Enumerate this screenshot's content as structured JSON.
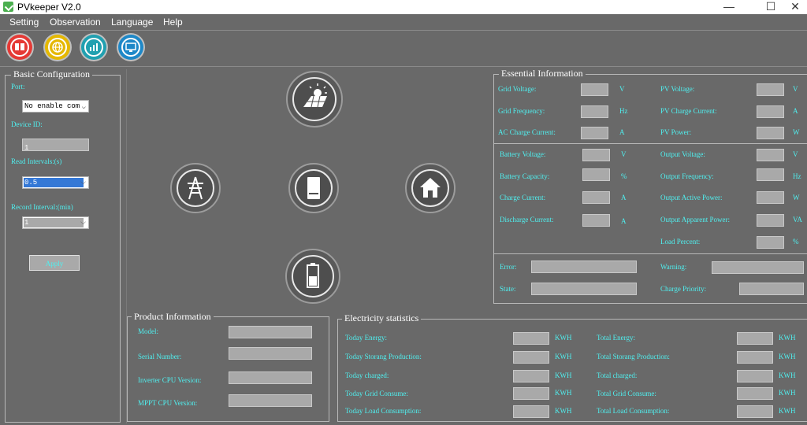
{
  "window": {
    "title": "PVkeeper V2.0",
    "minimize": "—",
    "maximize": "☐",
    "close": "✕"
  },
  "menu": [
    "Setting",
    "Observation",
    "Language",
    "Help"
  ],
  "toolbar": {
    "icons": [
      "book-icon",
      "globe-icon",
      "chart-icon",
      "monitor-icon"
    ]
  },
  "basic": {
    "title": "Basic Configuration",
    "port_label": "Port:",
    "port_value": "No enable com",
    "device_label": "Device ID:",
    "device_value": "1",
    "read_label": "Read Intervals:(s)",
    "read_value": "0.5",
    "record_label": "Record Interval:(min)",
    "record_value": "1",
    "apply": "Apply"
  },
  "essential": {
    "title": "Essential Information",
    "grid": [
      {
        "label": "Grid Voltage:",
        "unit": "V"
      },
      {
        "label": "Grid Frequency:",
        "unit": "Hz"
      },
      {
        "label": "AC Charge Current:",
        "unit": "A"
      }
    ],
    "pv": [
      {
        "label": "PV Voltage:",
        "unit": "V"
      },
      {
        "label": "PV Charge Current:",
        "unit": "A"
      },
      {
        "label": "PV Power:",
        "unit": "W"
      }
    ],
    "battery": [
      {
        "label": "Battery Voltage:",
        "unit": "V"
      },
      {
        "label": "Battery Capacity:",
        "unit": "%"
      },
      {
        "label": "Charge Current:",
        "unit": "A"
      },
      {
        "label": "Discharge Current:",
        "unit": "A"
      }
    ],
    "output": [
      {
        "label": "Output Voltage:",
        "unit": "V"
      },
      {
        "label": "Output Frequency:",
        "unit": "Hz"
      },
      {
        "label": "Output Active Power:",
        "unit": "W"
      },
      {
        "label": "Output Apparent Power:",
        "unit": "VA"
      },
      {
        "label": "Load Percent:",
        "unit": "%"
      }
    ],
    "status": {
      "error": "Error:",
      "warning": "Warning:",
      "state": "State:",
      "priority": "Charge Priority:"
    }
  },
  "product": {
    "title": "Product Information",
    "model": "Model:",
    "serial": "Serial Number:",
    "inverter": "Inverter CPU Version:",
    "mppt": "MPPT CPU Version:"
  },
  "stats": {
    "title": "Electricity statistics",
    "left": [
      {
        "label": "Today Energy:",
        "unit": "KWH"
      },
      {
        "label": "Today Storang Production:",
        "unit": "KWH"
      },
      {
        "label": "Today charged:",
        "unit": "KWH"
      },
      {
        "label": "Today Grid Consume:",
        "unit": "KWH"
      },
      {
        "label": "Today Load Consumption:",
        "unit": "KWH"
      }
    ],
    "right": [
      {
        "label": "Total Energy:",
        "unit": "KWH"
      },
      {
        "label": "Total Storang Production:",
        "unit": "KWH"
      },
      {
        "label": "Total charged:",
        "unit": "KWH"
      },
      {
        "label": "Total Grid Consume:",
        "unit": "KWH"
      },
      {
        "label": "Total Load Consumption:",
        "unit": "KWH"
      }
    ]
  },
  "colors": {
    "label": "#4ff0f0",
    "background": "#696969",
    "field": "#a9a9a9"
  }
}
